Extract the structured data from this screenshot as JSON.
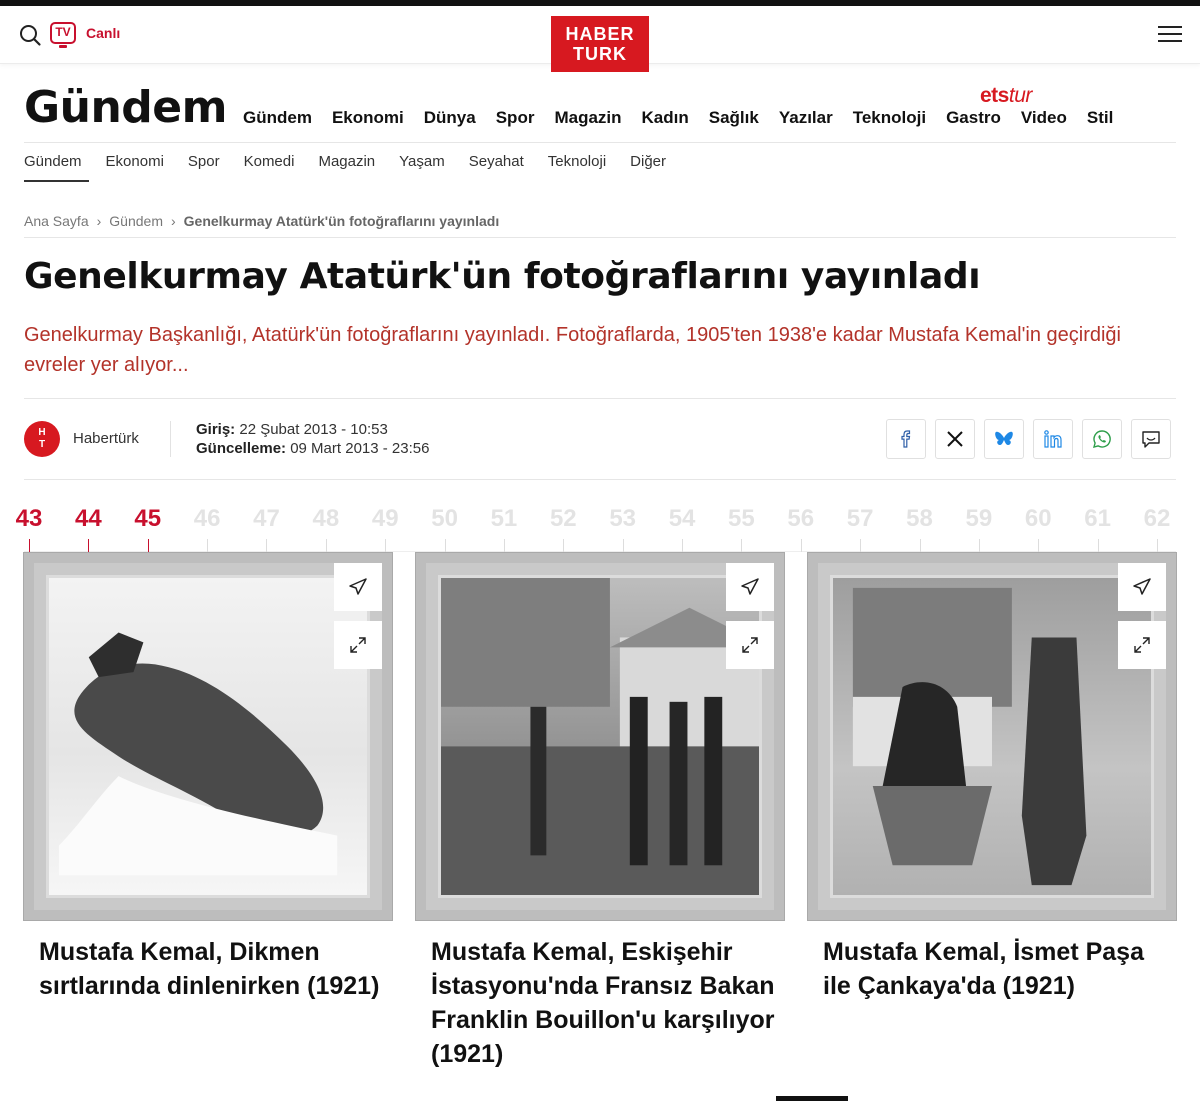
{
  "header": {
    "tv_label": "TV",
    "live_label": "Canlı",
    "logo_line1": "HABER",
    "logo_line2": "TURK"
  },
  "section": {
    "title": "Gündem"
  },
  "main_nav": [
    "Gündem",
    "Ekonomi",
    "Dünya",
    "Spor",
    "Magazin",
    "Kadın",
    "Sağlık",
    "Yazılar",
    "Teknoloji",
    "Gastro",
    "Video",
    "Stil"
  ],
  "etstur": {
    "part1": "ets",
    "part2": "tur"
  },
  "sub_nav": [
    "Gündem",
    "Ekonomi",
    "Spor",
    "Komedi",
    "Magazin",
    "Yaşam",
    "Seyahat",
    "Teknoloji",
    "Diğer"
  ],
  "breadcrumb": [
    "Ana Sayfa",
    "Gündem",
    "Genelkurmay Atatürk'ün fotoğraflarını yayınladı"
  ],
  "article": {
    "headline": "Genelkurmay Atatürk'ün fotoğraflarını yayınladı",
    "spot": "Genelkurmay Başkanlığı, Atatürk'ün fotoğraflarını yayınladı. Fotoğraflarda, 1905'ten 1938'e kadar Mustafa Kemal'in geçirdiği evreler yer alıyor..."
  },
  "author": {
    "avatar_text_1": "H",
    "avatar_text_2": "T",
    "name": "Habertürk"
  },
  "dates": {
    "entry_label": "Giriş:",
    "entry_value": "22 Şubat 2013 - 10:53",
    "update_label": "Güncelleme:",
    "update_value": "09 Mart 2013 - 23:56"
  },
  "share_icons": [
    "facebook-icon",
    "x-icon",
    "bluesky-icon",
    "linkedin-icon",
    "whatsapp-icon",
    "comment-icon"
  ],
  "pager": {
    "pages": [
      "43",
      "44",
      "45",
      "46",
      "47",
      "48",
      "49",
      "50",
      "51",
      "52",
      "53",
      "54",
      "55",
      "56",
      "57",
      "58",
      "59",
      "60",
      "61",
      "62"
    ],
    "active_pages": [
      "43",
      "44",
      "45"
    ]
  },
  "cards": [
    {
      "caption": "Mustafa Kemal, Dikmen sırtlarında dinlenirken (1921)"
    },
    {
      "caption": "Mustafa Kemal, Eskişehir İstasyonu'nda Fransız Bakan Franklin Bouillon'u karşılıyor (1921)"
    },
    {
      "caption": "Mustafa Kemal, İsmet Paşa ile Çankaya'da (1921)"
    }
  ],
  "colors": {
    "brand_red": "#d71920",
    "spot_text": "#b3332a",
    "active_page": "#c8102e",
    "inactive_page": "#e3e3e3"
  }
}
